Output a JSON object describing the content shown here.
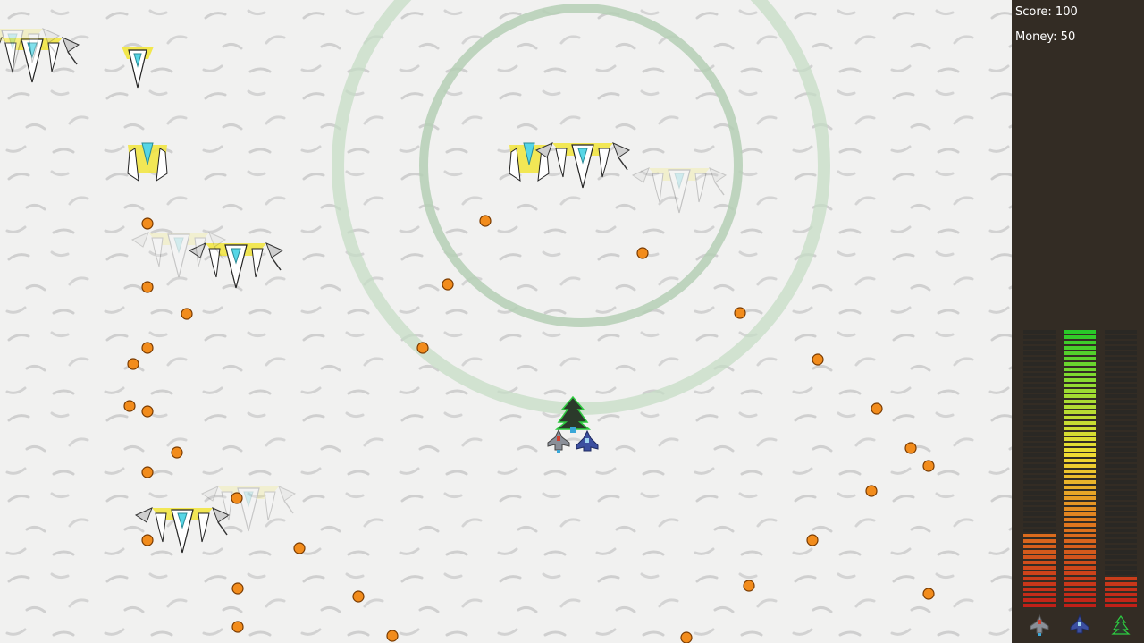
{
  "hud": {
    "score_label": "Score:",
    "score_value": "100",
    "money_label": "Money:",
    "money_value": "50",
    "score_text": "Score: 100",
    "money_text": "Money: 50"
  },
  "meters": [
    {
      "ship": "red-gray-fighter-icon",
      "level": 0.27
    },
    {
      "ship": "blue-fighter-icon",
      "level": 1.0
    },
    {
      "ship": "green-tree-fighter-icon",
      "level": 0.11
    }
  ],
  "colors": {
    "playfield_bg": "#f1f1f0",
    "hud_bg": "#332c24",
    "bullet": "#f28c1c",
    "bullet_outline": "#7a3b00",
    "shield_ring": "#b9d4b9",
    "enemy_yellow": "#f2e53a"
  },
  "player": {
    "ship": "green-tree-fighter",
    "wingmen": [
      "red-gray-fighter",
      "blue-fighter"
    ]
  }
}
